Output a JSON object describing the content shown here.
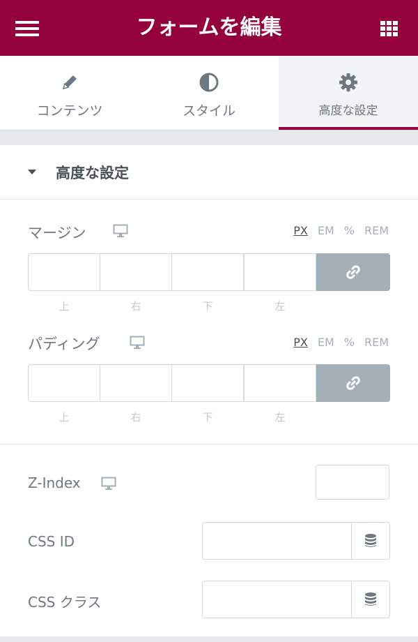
{
  "header": {
    "title": "フォームを編集",
    "bg_color": "#93003c"
  },
  "tabs": [
    {
      "label": "コンテンツ",
      "icon": "pencil-icon"
    },
    {
      "label": "スタイル",
      "icon": "contrast-icon"
    },
    {
      "label": "高度な設定",
      "icon": "gear-icon",
      "active": true
    }
  ],
  "section": {
    "title": "高度な設定"
  },
  "margin": {
    "label": "マージン",
    "units": [
      "PX",
      "EM",
      "%",
      "REM"
    ],
    "active_unit": "PX",
    "values": [
      "",
      "",
      "",
      ""
    ],
    "sides": [
      "上",
      "右",
      "下",
      "左"
    ]
  },
  "padding": {
    "label": "パディング",
    "units": [
      "PX",
      "EM",
      "%",
      "REM"
    ],
    "active_unit": "PX",
    "values": [
      "",
      "",
      "",
      ""
    ],
    "sides": [
      "上",
      "右",
      "下",
      "左"
    ]
  },
  "zindex": {
    "label": "Z-Index",
    "value": ""
  },
  "css_id": {
    "label": "CSS ID",
    "value": ""
  },
  "css_class": {
    "label": "CSS クラス",
    "value": ""
  }
}
